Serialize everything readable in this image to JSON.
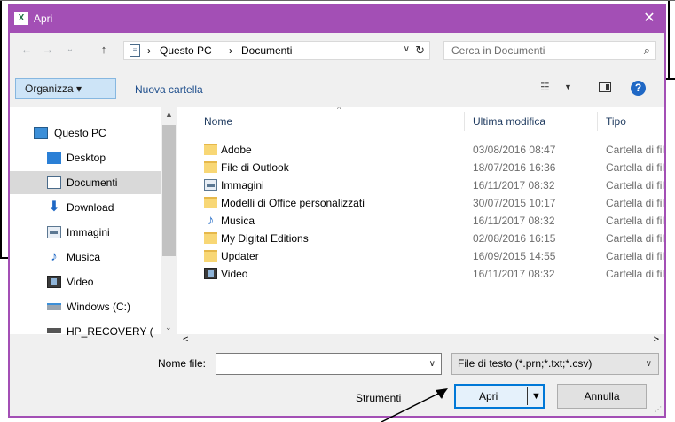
{
  "window": {
    "title": "Apri",
    "app_icon": "X",
    "close_glyph": "✕"
  },
  "address": {
    "back_glyph": "←",
    "forward_glyph": "→",
    "recent_glyph": "⌄",
    "up_glyph": "↑",
    "crumbs": [
      "Questo PC",
      "Documenti"
    ],
    "sep": "›",
    "drop_glyph": "∨",
    "refresh_glyph": "↻"
  },
  "search": {
    "placeholder": "Cerca in Documenti",
    "icon": "⌕"
  },
  "toolbar": {
    "organize_label": "Organizza ▾",
    "new_folder_label": "Nuova cartella",
    "view_glyph": "☷",
    "view_drop": "▼",
    "help_glyph": "?"
  },
  "nav": {
    "items": [
      {
        "label": "Questo PC",
        "icon": "pc-icon"
      },
      {
        "label": "Desktop",
        "icon": "desktop-icon"
      },
      {
        "label": "Documenti",
        "icon": "documents-icon",
        "selected": true
      },
      {
        "label": "Download",
        "icon": "download-icon"
      },
      {
        "label": "Immagini",
        "icon": "pictures-icon"
      },
      {
        "label": "Musica",
        "icon": "music-icon"
      },
      {
        "label": "Video",
        "icon": "video-icon"
      },
      {
        "label": "Windows (C:)",
        "icon": "drive-icon"
      },
      {
        "label": "HP_RECOVERY (",
        "icon": "drive-icon"
      }
    ],
    "scroll_up": "▲",
    "scroll_down": "⌄"
  },
  "columns": {
    "name": "Nome",
    "modified": "Ultima modifica",
    "type": "Tipo",
    "sort_caret": "^"
  },
  "files": [
    {
      "name": "Adobe",
      "date": "03/08/2016 08:47",
      "type": "Cartella di file",
      "kind": "folder"
    },
    {
      "name": "File di Outlook",
      "date": "18/07/2016 16:36",
      "type": "Cartella di file",
      "kind": "folder"
    },
    {
      "name": "Immagini",
      "date": "16/11/2017 08:32",
      "type": "Cartella di file",
      "kind": "image"
    },
    {
      "name": "Modelli di Office personalizzati",
      "date": "30/07/2015 10:17",
      "type": "Cartella di file",
      "kind": "folder"
    },
    {
      "name": "Musica",
      "date": "16/11/2017 08:32",
      "type": "Cartella di file",
      "kind": "music"
    },
    {
      "name": "My Digital Editions",
      "date": "02/08/2016 16:15",
      "type": "Cartella di file",
      "kind": "folder"
    },
    {
      "name": "Updater",
      "date": "16/09/2015 14:55",
      "type": "Cartella di file",
      "kind": "folder"
    },
    {
      "name": "Video",
      "date": "16/11/2017 08:32",
      "type": "Cartella di file",
      "kind": "video"
    }
  ],
  "hscroll": {
    "left": "<",
    "right": ">"
  },
  "footer": {
    "filename_label": "Nome file:",
    "filename_value": "",
    "filename_drop": "∨",
    "filter": "File di testo (*.prn;*.txt;*.csv)",
    "filter_drop": "∨",
    "tools_label": "Strumenti",
    "tools_drop": "▼",
    "open_label": "Apri",
    "open_drop": "▼",
    "cancel_label": "Annulla"
  },
  "colors": {
    "titlebar": "#a34fb5",
    "accent": "#0078d7"
  }
}
